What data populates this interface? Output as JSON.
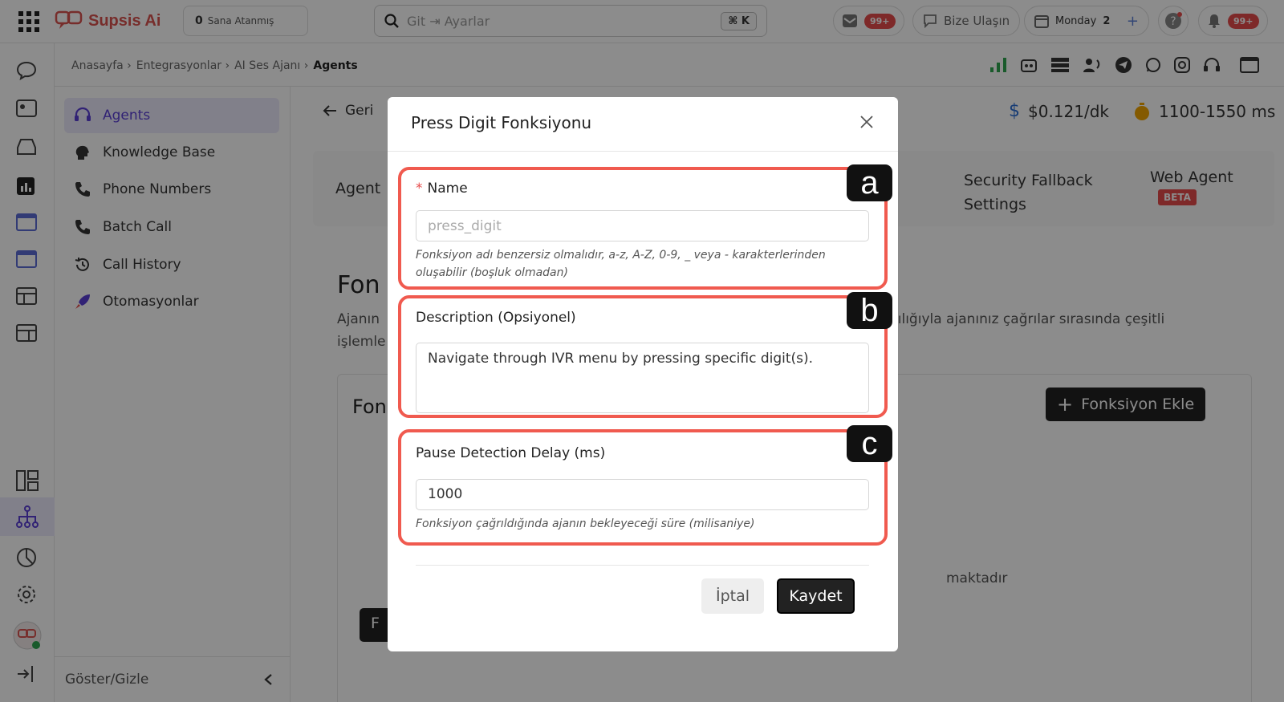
{
  "brand": {
    "name": "Supsis Ai"
  },
  "assigned": {
    "count": "0",
    "label": "Sana Atanmış"
  },
  "search": {
    "value": "Git ⇥ Ayarlar",
    "shortcut": "⌘ K"
  },
  "top": {
    "inbox_badge": "99+",
    "contact": "Bize Ulaşın",
    "day": "Monday",
    "day_num": "2",
    "notif_badge": "99+"
  },
  "breadcrumb": {
    "items": [
      "Anasayfa ›",
      "Entegrasyonlar ›",
      "AI Ses Ajanı ›"
    ],
    "current": "Agents"
  },
  "subnav": {
    "items": [
      "Agents",
      "Knowledge Base",
      "Phone Numbers",
      "Batch Call",
      "Call History",
      "Otomasyonlar"
    ],
    "toggle": "Göster/Gizle"
  },
  "main": {
    "back": "Geri",
    "price": "$0.121/dk",
    "latency": "1100-1550 ms",
    "tab_agent": "Agent",
    "tab_security": "Security Fallback Settings",
    "tab_web": "Web Agent",
    "beta": "BETA",
    "heading": "Fon",
    "desc_l1": "Ajanın",
    "desc_l1_right": "acılığıyla ajanınız çağrılar sırasında çeşitli",
    "desc_l2": "işlemle",
    "section": "Fon",
    "add_btn": "Fonksiyon Ekle",
    "empty_right": "maktadır",
    "left_btn": "F"
  },
  "modal": {
    "title": "Press Digit Fonksiyonu",
    "name_label": "Name",
    "name_placeholder": "press_digit",
    "name_help": "Fonksiyon adı benzersiz olmalıdır, a-z, A-Z, 0-9, _ veya - karakterlerinden oluşabilir (boşluk olmadan)",
    "desc_label": "Description (Opsiyonel)",
    "desc_value": "Navigate through IVR menu by pressing specific digit(s).",
    "delay_label": "Pause Detection Delay (ms)",
    "delay_value": "1000",
    "delay_help": "Fonksiyon çağrıldığında ajanın bekleyeceği süre (milisaniye)",
    "cancel": "İptal",
    "save": "Kaydet"
  },
  "annotations": [
    "a",
    "b",
    "c"
  ]
}
